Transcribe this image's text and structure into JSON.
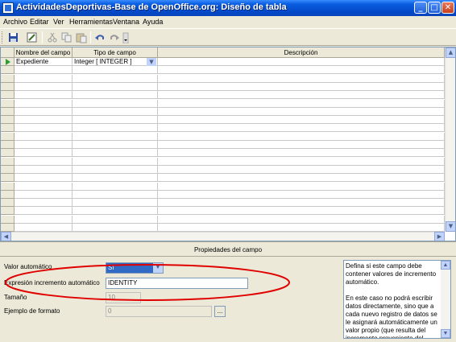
{
  "window": {
    "title": "ActividadesDeportivas-Base de OpenOffice.org: Diseño de tabla",
    "minimize": "_",
    "maximize": "□",
    "close": "✕"
  },
  "menu": [
    "Archivo",
    "Editar",
    "Ver",
    "Herramientas",
    "Ventana",
    "Ayuda"
  ],
  "toolbar": {
    "icons": [
      "save-icon",
      "edit-icon",
      "cut-icon",
      "copy-icon",
      "paste-icon",
      "undo-icon",
      "redo-icon",
      "overflow-icon"
    ]
  },
  "table": {
    "columns": [
      "Nombre del campo",
      "Tipo de campo",
      "Descripción"
    ],
    "rows": [
      {
        "name": "Expediente",
        "type": "Integer [ INTEGER ]",
        "description": ""
      }
    ]
  },
  "properties": {
    "title": "Propiedades del campo",
    "fields": [
      {
        "label": "Valor automático",
        "value": "Sí",
        "kind": "select"
      },
      {
        "label": "Expresión incremento automático",
        "value": "IDENTITY",
        "kind": "text"
      },
      {
        "label": "Tamaño",
        "value": "10",
        "kind": "spin"
      },
      {
        "label": "Ejemplo de formato",
        "value": "0",
        "kind": "format",
        "button": "..."
      }
    ],
    "help": [
      "Defina si este campo debe contener valores de incremento automático.",
      "En este caso no podrá escribir datos directamente, sino que a cada nuevo registro de datos se le asignará automáticamente un valor propio (que resulta del incremento proveniente del"
    ]
  },
  "colors": {
    "titlebar": "#0348c8",
    "highlight": "#316ac5",
    "annotation": "#e00000"
  }
}
